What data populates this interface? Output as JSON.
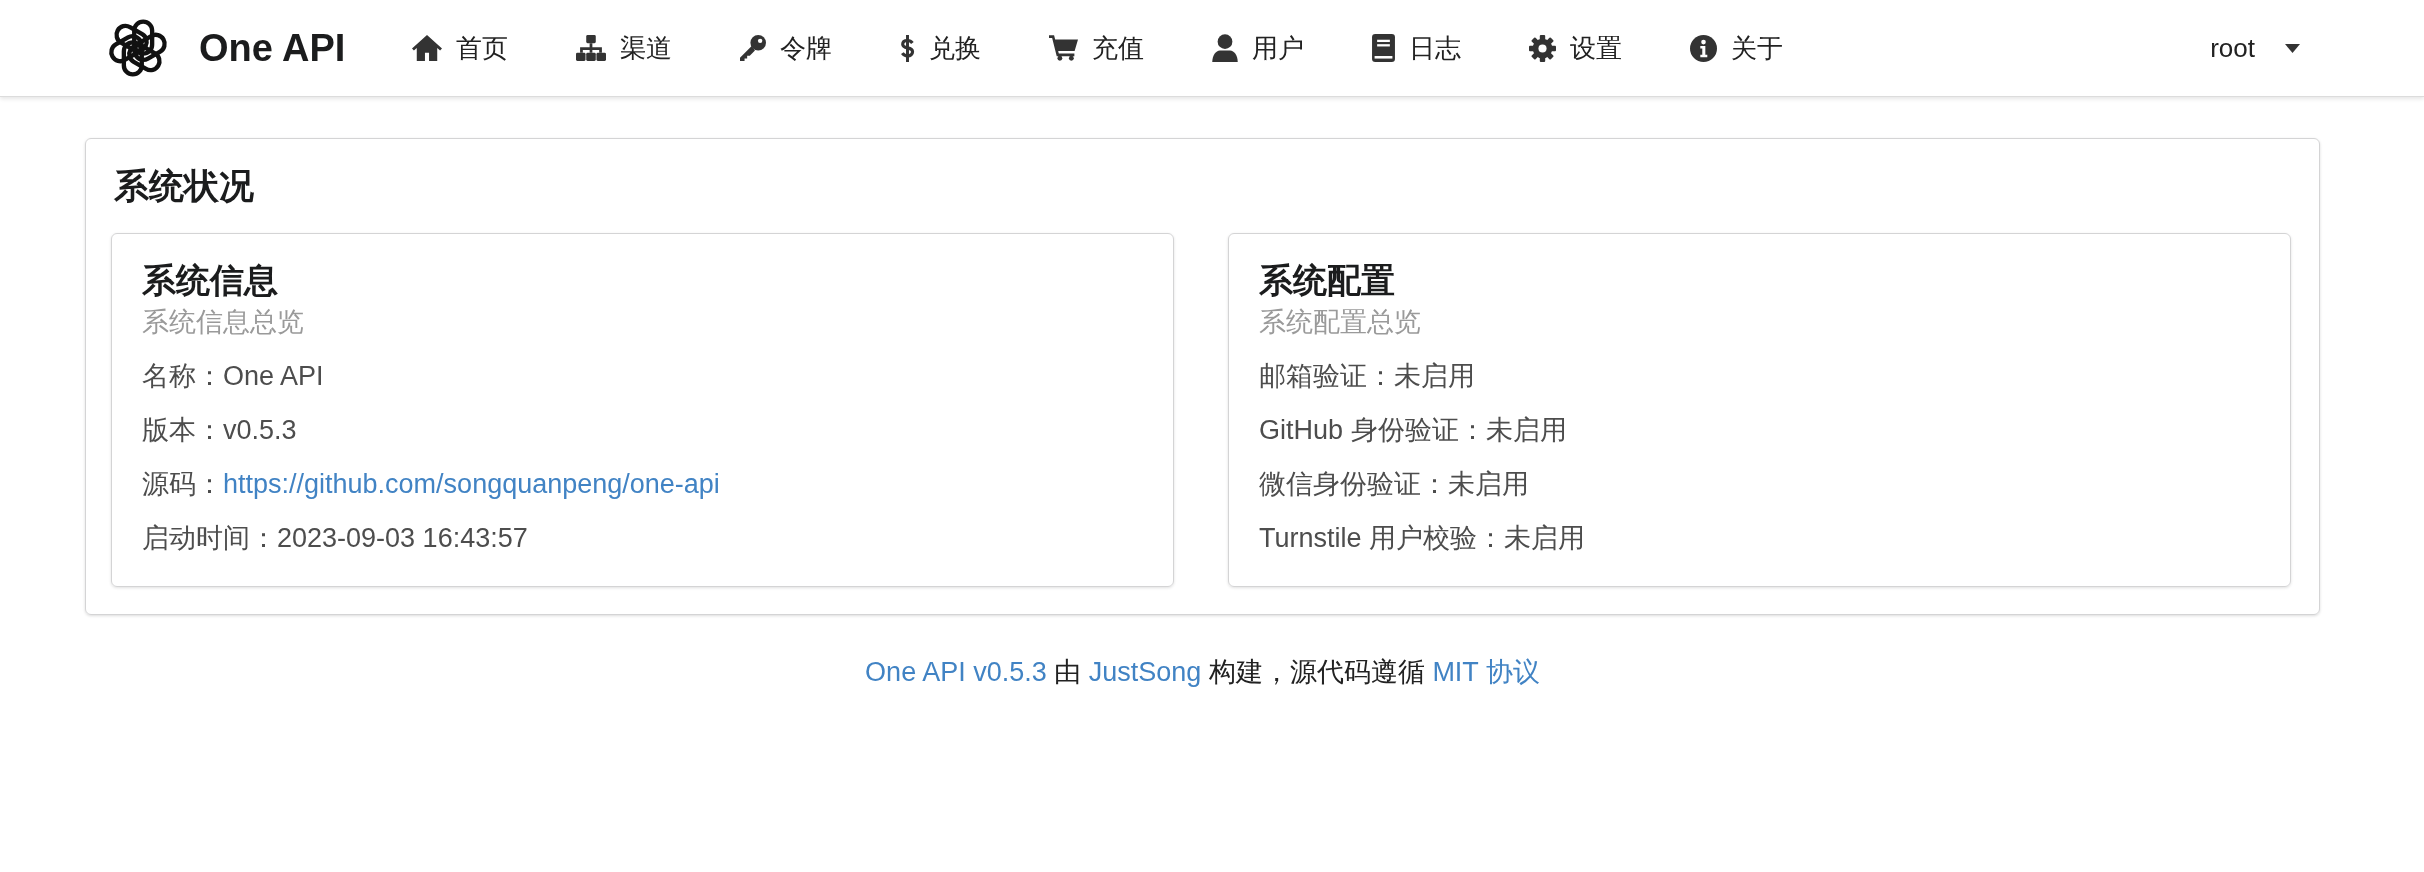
{
  "navbar": {
    "brand": "One API",
    "items": [
      {
        "label": "首页",
        "selected": false
      },
      {
        "label": "渠道",
        "selected": false
      },
      {
        "label": "令牌",
        "selected": false
      },
      {
        "label": "兑换",
        "selected": false
      },
      {
        "label": "充值",
        "selected": false
      },
      {
        "label": "用户",
        "selected": false
      },
      {
        "label": "日志",
        "selected": false
      },
      {
        "label": "设置",
        "selected": false
      },
      {
        "label": "关于",
        "selected": false
      }
    ],
    "user": "root"
  },
  "status_panel": {
    "title": "系统状况",
    "cards": [
      {
        "title": "系统信息",
        "subtitle": "系统信息总览",
        "rows": [
          {
            "label": "名称：",
            "value": "One API",
            "kind": "text"
          },
          {
            "label": "版本：",
            "value": "v0.5.3",
            "kind": "text"
          },
          {
            "label": "源码：",
            "value": "https://github.com/songquanpeng/one-api",
            "kind": "link"
          },
          {
            "label": "启动时间：",
            "value": "2023-09-03 16:43:57",
            "kind": "text"
          }
        ]
      },
      {
        "title": "系统配置",
        "subtitle": "系统配置总览",
        "rows": [
          {
            "label": "邮箱验证：",
            "value": "未启用",
            "kind": "text"
          },
          {
            "label": "GitHub 身份验证：",
            "value": "未启用",
            "kind": "text"
          },
          {
            "label": "微信身份验证：",
            "value": "未启用",
            "kind": "text"
          },
          {
            "label": "Turnstile 用户校验：",
            "value": "未启用",
            "kind": "text"
          }
        ]
      }
    ]
  },
  "footer": {
    "parts": [
      {
        "text": "One API v0.5.3",
        "kind": "link"
      },
      {
        "text": "由",
        "kind": "text"
      },
      {
        "text": "JustSong",
        "kind": "link"
      },
      {
        "text": "构建，源代码遵循",
        "kind": "text"
      },
      {
        "text": "MIT 协议",
        "kind": "link"
      }
    ]
  }
}
